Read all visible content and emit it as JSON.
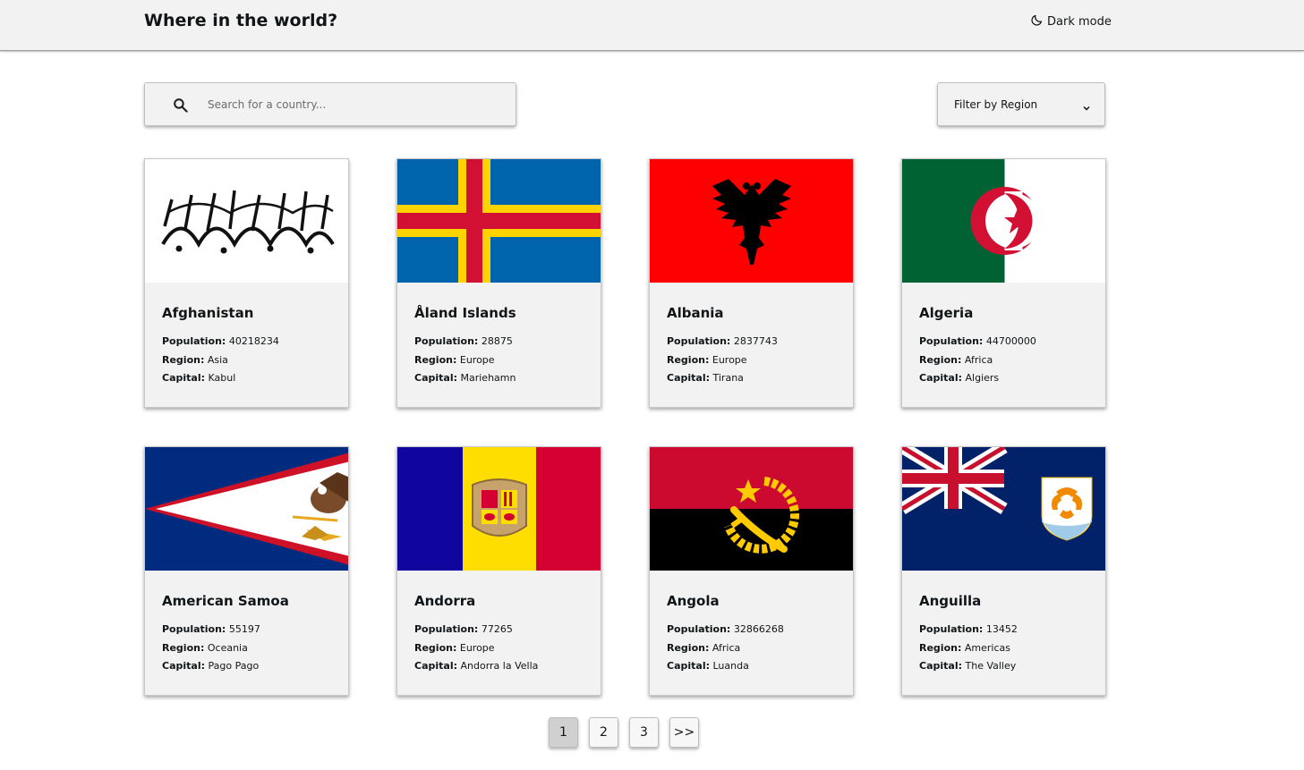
{
  "header": {
    "title": "Where in the world?",
    "dark_mode_label": "Dark mode"
  },
  "search": {
    "placeholder": "Search for a country...",
    "value": ""
  },
  "filter": {
    "label": "Filter by Region"
  },
  "labels": {
    "population": "Population:",
    "region": "Region:",
    "capital": "Capital:"
  },
  "countries": [
    {
      "name": "Afghanistan",
      "population": "40218234",
      "region": "Asia",
      "capital": "Kabul"
    },
    {
      "name": "Åland Islands",
      "population": "28875",
      "region": "Europe",
      "capital": "Mariehamn"
    },
    {
      "name": "Albania",
      "population": "2837743",
      "region": "Europe",
      "capital": "Tirana"
    },
    {
      "name": "Algeria",
      "population": "44700000",
      "region": "Africa",
      "capital": "Algiers"
    },
    {
      "name": "American Samoa",
      "population": "55197",
      "region": "Oceania",
      "capital": "Pago Pago"
    },
    {
      "name": "Andorra",
      "population": "77265",
      "region": "Europe",
      "capital": "Andorra la Vella"
    },
    {
      "name": "Angola",
      "population": "32866268",
      "region": "Africa",
      "capital": "Luanda"
    },
    {
      "name": "Anguilla",
      "population": "13452",
      "region": "Americas",
      "capital": "The Valley"
    }
  ],
  "pagination": {
    "pages": [
      "1",
      "2",
      "3"
    ],
    "next_label": ">>",
    "current": "1"
  },
  "colors": {
    "header_bg": "#f2f2f2",
    "card_bg": "#f2f2f2",
    "active_page_bg": "#d0d0d0"
  }
}
